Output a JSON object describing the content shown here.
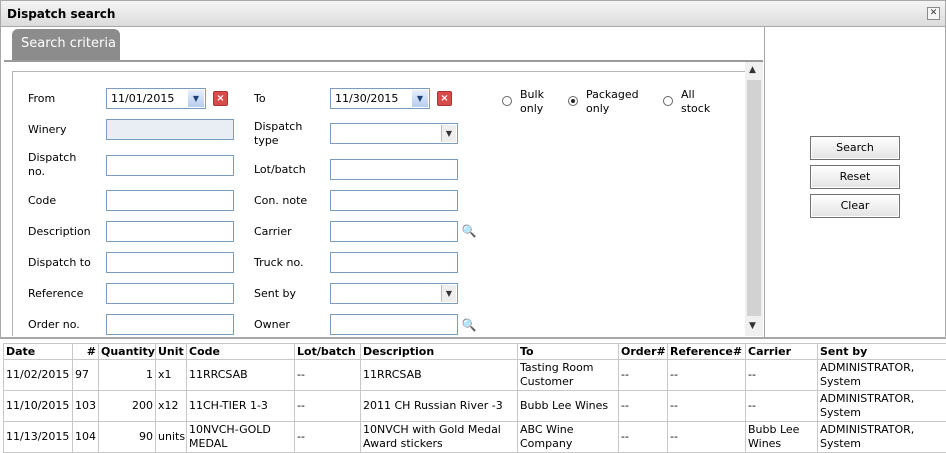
{
  "window": {
    "title": "Dispatch search"
  },
  "tab": {
    "label": "Search criteria"
  },
  "form": {
    "from_label": "From",
    "from_value": "11/01/2015",
    "to_label": "To",
    "to_value": "11/30/2015",
    "winery_label": "Winery",
    "winery_value": "",
    "dispatch_type_label": "Dispatch type",
    "dispatch_type_value": "",
    "dispatch_no_label": "Dispatch no.",
    "dispatch_no_value": "",
    "lot_batch_label": "Lot/batch",
    "lot_batch_value": "",
    "code_label": "Code",
    "code_value": "",
    "con_note_label": "Con. note",
    "con_note_value": "",
    "description_label": "Description",
    "description_value": "",
    "carrier_label": "Carrier",
    "carrier_value": "",
    "dispatch_to_label": "Dispatch to",
    "dispatch_to_value": "",
    "truck_no_label": "Truck no.",
    "truck_no_value": "",
    "reference_label": "Reference",
    "reference_value": "",
    "sent_by_label": "Sent by",
    "sent_by_value": "",
    "order_no_label": "Order no.",
    "order_no_value": "",
    "owner_label": "Owner",
    "owner_value": ""
  },
  "stock_options": {
    "bulk": "Bulk only",
    "packaged": "Packaged only",
    "all": "All stock",
    "selected": "packaged"
  },
  "buttons": {
    "search": "Search",
    "reset": "Reset",
    "clear": "Clear"
  },
  "table": {
    "headers": [
      "Date",
      "#",
      "Quantity",
      "Unit",
      "Code",
      "Lot/batch",
      "Description",
      "To",
      "Order#",
      "Reference#",
      "Carrier",
      "Sent by"
    ],
    "rows": [
      [
        "11/02/2015",
        "97",
        "1",
        "x1",
        "11RRCSAB",
        "--",
        "11RRCSAB",
        "Tasting Room Customer",
        "--",
        "--",
        "--",
        "ADMINISTRATOR, System"
      ],
      [
        "11/10/2015",
        "103",
        "200",
        "x12",
        "11CH-TIER 1-3",
        "--",
        "2011 CH Russian River -3",
        "Bubb Lee Wines",
        "--",
        "--",
        "--",
        "ADMINISTRATOR, System"
      ],
      [
        "11/13/2015",
        "104",
        "90",
        "units",
        "10NVCH-GOLD MEDAL",
        "--",
        "10NVCH with Gold Medal Award stickers",
        "ABC Wine Company",
        "--",
        "--",
        "Bubb Lee Wines",
        "ADMINISTRATOR, System"
      ]
    ]
  }
}
